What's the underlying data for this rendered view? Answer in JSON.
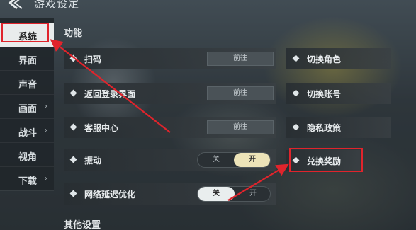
{
  "header": {
    "title": "游戏设定"
  },
  "sidebar": {
    "items": [
      {
        "label": "系统",
        "active": true,
        "chevron": false
      },
      {
        "label": "界面",
        "active": false,
        "chevron": false
      },
      {
        "label": "声音",
        "active": false,
        "chevron": false
      },
      {
        "label": "画面",
        "active": false,
        "chevron": true
      },
      {
        "label": "战斗",
        "active": false,
        "chevron": true
      },
      {
        "label": "视角",
        "active": false,
        "chevron": false
      },
      {
        "label": "下载",
        "active": false,
        "chevron": true
      }
    ],
    "chevron_glyph": "›"
  },
  "main": {
    "section_function": "功能",
    "section_other": "其他设置",
    "rows": {
      "scan": {
        "label": "扫码",
        "button": "前往"
      },
      "return_login": {
        "label": "返回登录界面",
        "button": "前往"
      },
      "customer_service": {
        "label": "客服中心",
        "button": "前往"
      },
      "vibration": {
        "label": "振动",
        "off": "关",
        "on": "开",
        "state": "开"
      },
      "network_opt": {
        "label": "网络延迟优化",
        "off": "关",
        "on": "开",
        "state": "关"
      }
    },
    "right_rows": {
      "switch_role": "切换角色",
      "switch_account": "切换账号",
      "privacy_policy": "隐私政策",
      "redeem_rewards": "兑换奖励"
    }
  },
  "colors": {
    "annotation_red": "#e0242c",
    "toggle_on_yellow": "#ece3b8",
    "toggle_on_white": "#e9eeee"
  }
}
